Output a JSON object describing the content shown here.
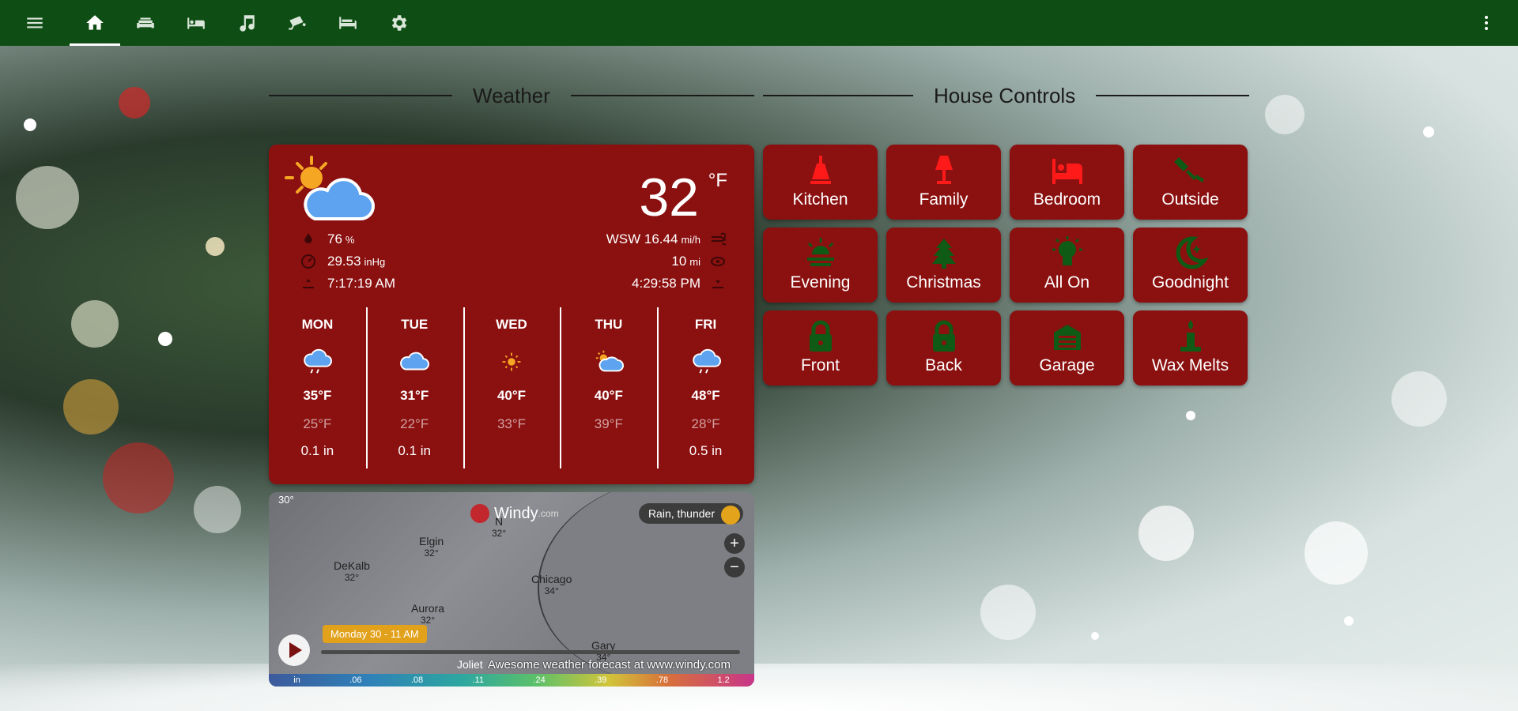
{
  "topbar": {
    "tabs": [
      {
        "icon": "home-icon",
        "active": true
      },
      {
        "icon": "sofa-icon",
        "active": false
      },
      {
        "icon": "bed-icon",
        "active": false
      },
      {
        "icon": "music-icon",
        "active": false
      },
      {
        "icon": "cctv-icon",
        "active": false
      },
      {
        "icon": "bed-empty-icon",
        "active": false
      },
      {
        "icon": "gear-icon",
        "active": false
      }
    ]
  },
  "sections": {
    "weather_title": "Weather",
    "house_title": "House Controls"
  },
  "weather": {
    "temperature": "32",
    "unit": "°F",
    "humidity": "76",
    "humidity_unit": "%",
    "pressure": "29.53",
    "pressure_unit": "inHg",
    "sunrise": "7:17:19 AM",
    "wind": "WSW 16.44",
    "wind_unit": "mi/h",
    "visibility": "10",
    "visibility_unit": "mi",
    "sunset": "4:29:58 PM",
    "forecast": [
      {
        "day": "MON",
        "icon": "rain-cloud-icon",
        "high": "35°F",
        "low": "25°F",
        "precip": "0.1 in"
      },
      {
        "day": "TUE",
        "icon": "cloudy-icon",
        "high": "31°F",
        "low": "22°F",
        "precip": "0.1 in"
      },
      {
        "day": "WED",
        "icon": "sunny-icon",
        "high": "40°F",
        "low": "33°F",
        "precip": ""
      },
      {
        "day": "THU",
        "icon": "partly-cloudy-icon",
        "high": "40°F",
        "low": "39°F",
        "precip": ""
      },
      {
        "day": "FRI",
        "icon": "rain-cloud-icon",
        "high": "48°F",
        "low": "28°F",
        "precip": "0.5 in"
      }
    ]
  },
  "map": {
    "brand": "Windy",
    "brand_suffix": ".com",
    "layer": "Rain, thunder",
    "time": "Monday 30 - 11 AM",
    "credit": "Awesome weather forecast at www.windy.com",
    "latitude": "30°",
    "labels": [
      {
        "name": "Elgin",
        "temp": "32°"
      },
      {
        "name": "DeKalb",
        "temp": "32°"
      },
      {
        "name": "Chicago",
        "temp": "34°"
      },
      {
        "name": "Aurora",
        "temp": "32°"
      },
      {
        "name": "Gary",
        "temp": "34°"
      },
      {
        "name": "N",
        "temp": "32°"
      }
    ],
    "joliet": "Joliet",
    "scale": [
      "in",
      ".06",
      ".08",
      ".11",
      ".24",
      ".39",
      ".78",
      "1.2"
    ]
  },
  "controls": [
    {
      "label": "Kitchen",
      "icon": "ceiling-light-icon",
      "color": "#ff1a1a"
    },
    {
      "label": "Family",
      "icon": "lamp-icon",
      "color": "#ff1a1a"
    },
    {
      "label": "Bedroom",
      "icon": "bed-icon",
      "color": "#ff1a1a"
    },
    {
      "label": "Outside",
      "icon": "spotlight-icon",
      "color": "#0f5a14"
    },
    {
      "label": "Evening",
      "icon": "sunset-icon",
      "color": "#0f5a14"
    },
    {
      "label": "Christmas",
      "icon": "tree-icon",
      "color": "#0f5a14"
    },
    {
      "label": "All On",
      "icon": "lightbulb-icon",
      "color": "#0f5a14"
    },
    {
      "label": "Goodnight",
      "icon": "moon-icon",
      "color": "#0f5a14"
    },
    {
      "label": "Front",
      "icon": "lock-icon",
      "color": "#0f5a14"
    },
    {
      "label": "Back",
      "icon": "lock-icon",
      "color": "#0f5a14"
    },
    {
      "label": "Garage",
      "icon": "garage-icon",
      "color": "#0f5a14"
    },
    {
      "label": "Wax Melts",
      "icon": "candle-icon",
      "color": "#0f5a14"
    }
  ]
}
